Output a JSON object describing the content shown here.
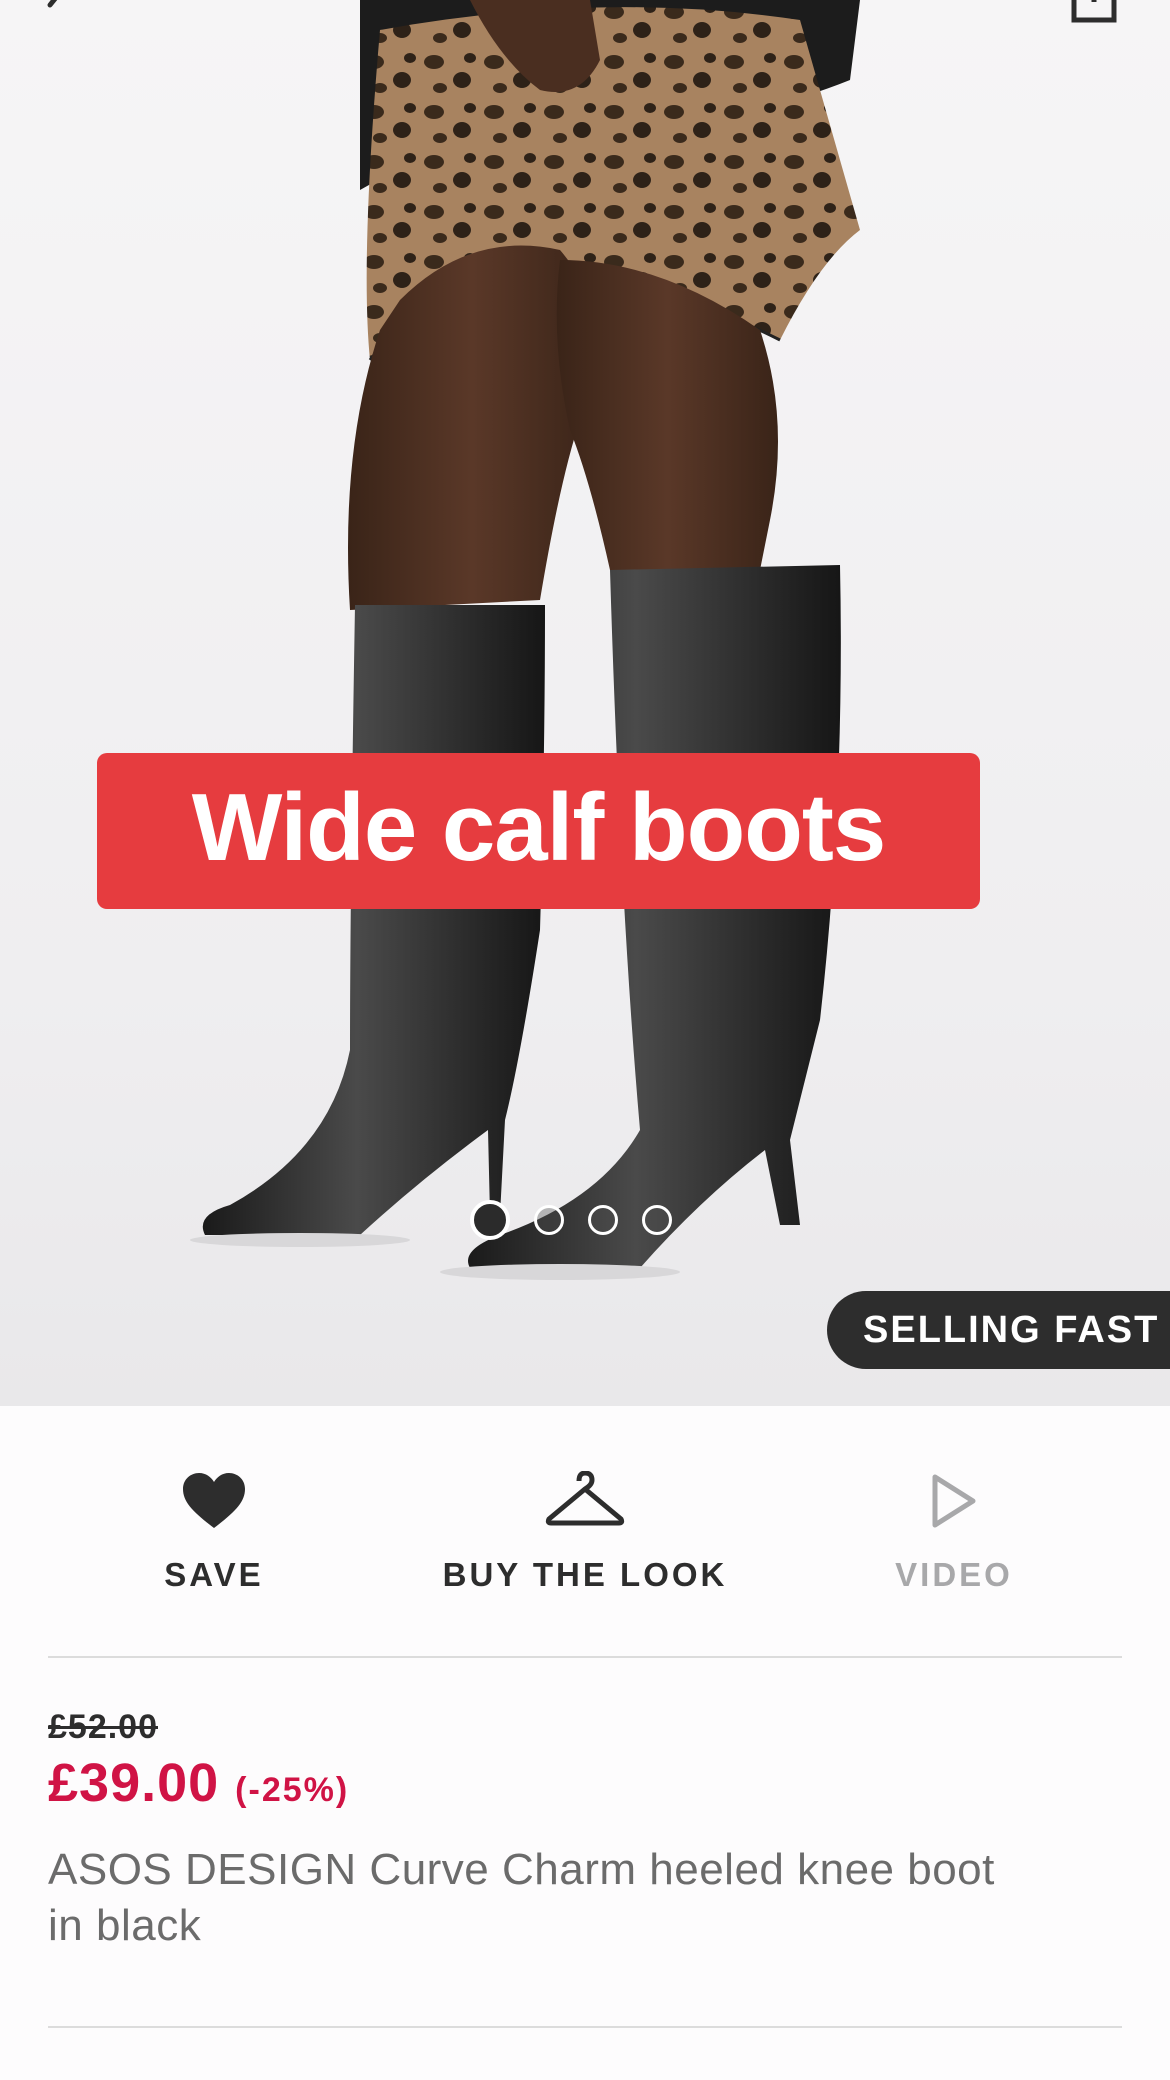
{
  "hero": {
    "promo_banner": "Wide calf boots",
    "badge": "SELLING FAST",
    "carousel": {
      "count": 4,
      "active_index": 0
    }
  },
  "actions": {
    "save_label": "SAVE",
    "buy_the_look_label": "BUY THE LOOK",
    "video_label": "VIDEO"
  },
  "product": {
    "old_price": "£52.00",
    "price": "£39.00",
    "discount": "(-25%)",
    "name": "ASOS DESIGN Curve Charm heeled knee boot in black"
  },
  "colors": {
    "sale_price": "#d01345",
    "promo_banner": "#e63c3f",
    "badge_bg": "#2d2d2d"
  },
  "icons": [
    "back-arrow-icon",
    "share-icon",
    "heart-icon",
    "hanger-icon",
    "play-icon"
  ]
}
